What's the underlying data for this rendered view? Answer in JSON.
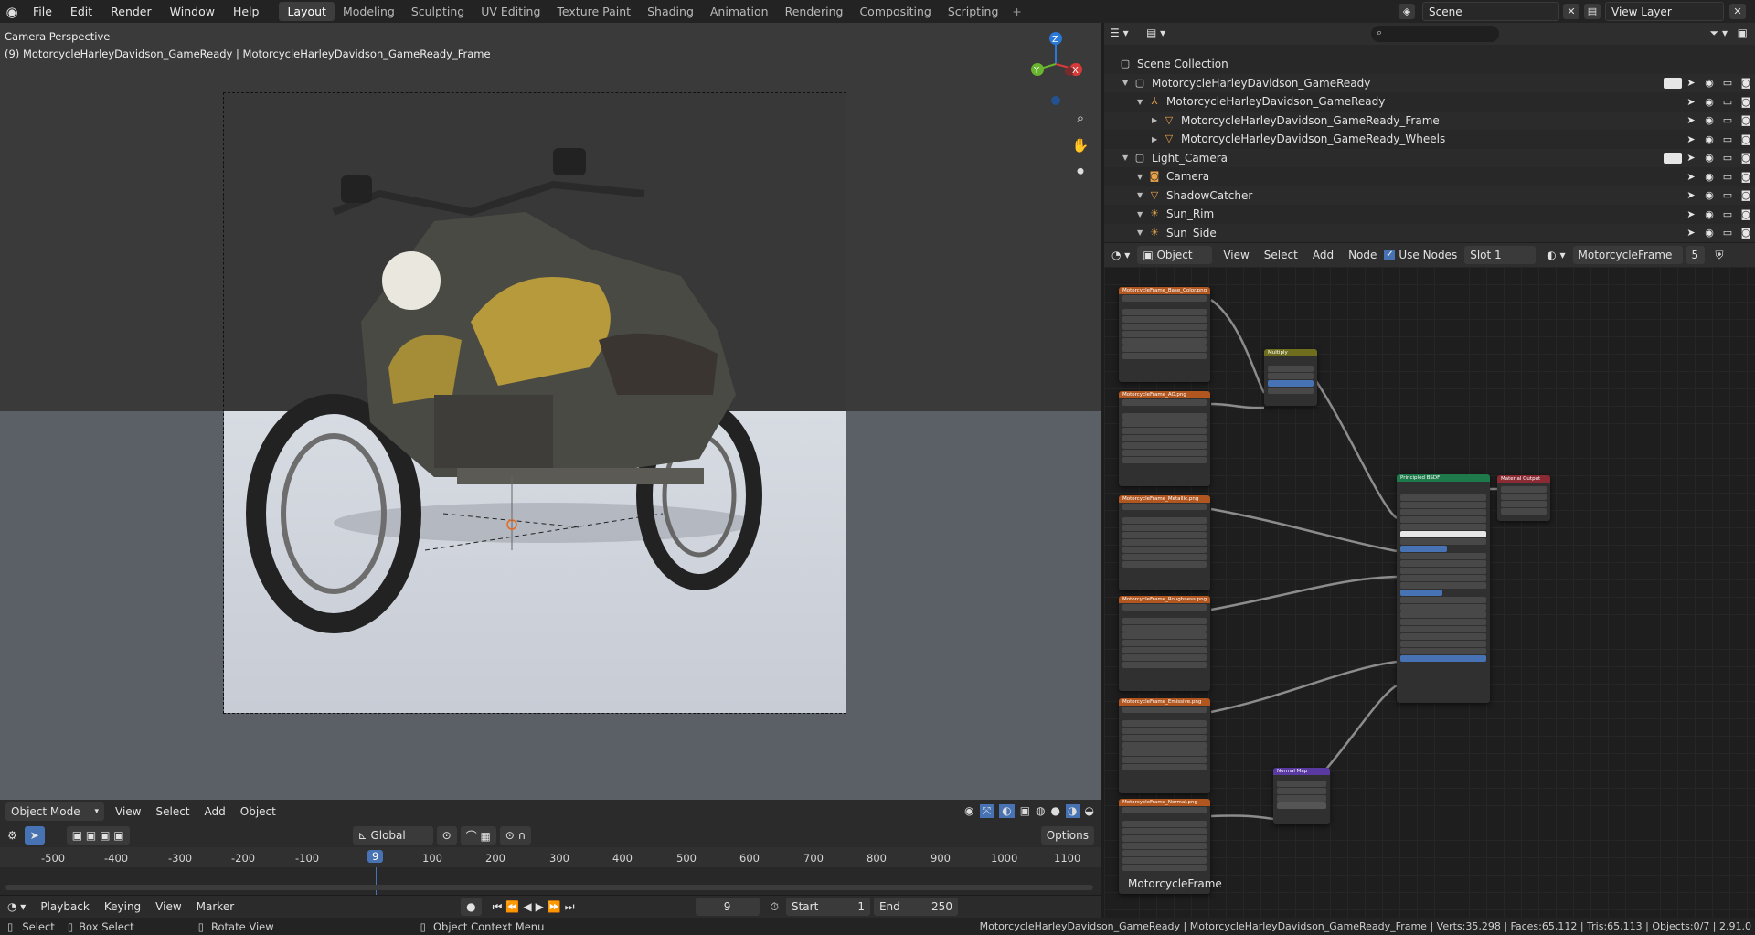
{
  "topbar": {
    "menus": [
      "File",
      "Edit",
      "Render",
      "Window",
      "Help"
    ],
    "workspaces": [
      "Layout",
      "Modeling",
      "Sculpting",
      "UV Editing",
      "Texture Paint",
      "Shading",
      "Animation",
      "Rendering",
      "Compositing",
      "Scripting"
    ],
    "active_workspace": "Layout",
    "scene_name": "Scene",
    "view_layer": "View Layer"
  },
  "viewport": {
    "title": "Camera Perspective",
    "subtitle": "(9) MotorcycleHarleyDavidson_GameReady | MotorcycleHarleyDavidson_GameReady_Frame",
    "gizmo": {
      "z": "Z",
      "y": "Y",
      "x": "X"
    }
  },
  "viewport_header": {
    "mode": "Object Mode",
    "menus": [
      "View",
      "Select",
      "Add",
      "Object"
    ],
    "transform_orientation": "Global",
    "options_label": "Options"
  },
  "timeline": {
    "ruler_ticks": [
      "-500",
      "-400",
      "-300",
      "-200",
      "-100",
      "9",
      "100",
      "200",
      "300",
      "400",
      "500",
      "600",
      "700",
      "800",
      "900",
      "1000",
      "1100"
    ],
    "current_frame": "9",
    "start_label": "Start",
    "start": "1",
    "end_label": "End",
    "end": "250",
    "menus": [
      "Playback",
      "Keying",
      "View",
      "Marker"
    ]
  },
  "outliner": {
    "rows": [
      {
        "label": "Scene Collection",
        "indent": 0,
        "icon": "collection-icon"
      },
      {
        "label": "MotorcycleHarleyDavidson_GameReady",
        "indent": 1,
        "icon": "collection-icon"
      },
      {
        "label": "MotorcycleHarleyDavidson_GameReady",
        "indent": 2,
        "icon": "armature-icon"
      },
      {
        "label": "MotorcycleHarleyDavidson_GameReady_Frame",
        "indent": 3,
        "icon": "mesh-icon"
      },
      {
        "label": "MotorcycleHarleyDavidson_GameReady_Wheels",
        "indent": 3,
        "icon": "mesh-icon"
      },
      {
        "label": "Light_Camera",
        "indent": 1,
        "icon": "collection-icon"
      },
      {
        "label": "Camera",
        "indent": 2,
        "icon": "camera-icon"
      },
      {
        "label": "ShadowCatcher",
        "indent": 2,
        "icon": "mesh-icon"
      },
      {
        "label": "Sun_Rim",
        "indent": 2,
        "icon": "light-icon"
      },
      {
        "label": "Sun_Side",
        "indent": 2,
        "icon": "light-icon"
      }
    ]
  },
  "node_editor": {
    "object_mode": "Object",
    "menus": [
      "View",
      "Select",
      "Add",
      "Node"
    ],
    "use_nodes_label": "Use Nodes",
    "slot": "Slot 1",
    "material": "MotorcycleFrame",
    "users": "5",
    "corner_label": "MotorcycleFrame",
    "nodes": {
      "tex1": "MotorcycleFrame_Base_Color.png",
      "tex2": "MotorcycleFrame_AO.png",
      "tex3": "MotorcycleFrame_Metallic.png",
      "tex4": "MotorcycleFrame_Roughness.png",
      "tex5": "MotorcycleFrame_Emissive.png",
      "tex6": "MotorcycleFrame_Normal.png",
      "multiply": "Multiply",
      "bsdf": "Principled BSDF",
      "output": "Material Output",
      "normal_map": "Normal Map"
    }
  },
  "statusbar": {
    "select": "Select",
    "box_select": "Box Select",
    "rotate_view": "Rotate View",
    "context_menu": "Object Context Menu",
    "stats": "MotorcycleHarleyDavidson_GameReady | MotorcycleHarleyDavidson_GameReady_Frame | Verts:35,298 | Faces:65,112 | Tris:65,113 | Objects:0/7 | 2.91.0"
  }
}
